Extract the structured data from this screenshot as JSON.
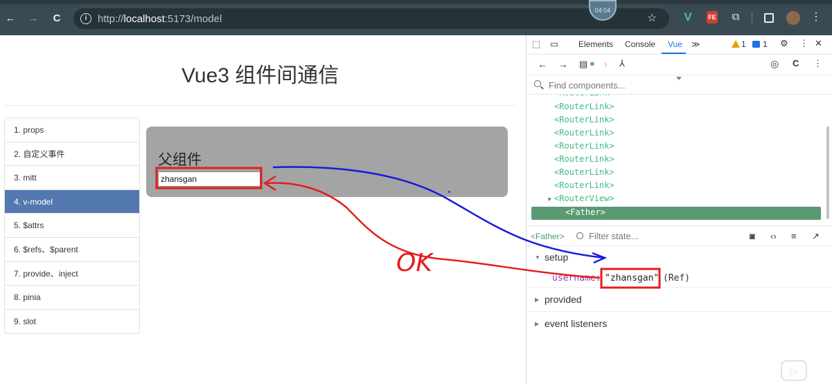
{
  "browser": {
    "url_prefix": "http://",
    "url_host": "localhost",
    "url_rest": ":5173/model",
    "timer": "04:04",
    "back": "←",
    "forward": "→",
    "reload": "C"
  },
  "page": {
    "title": "Vue3 组件间通信",
    "nav": [
      {
        "label": "1. props",
        "active": false
      },
      {
        "label": "2. 自定义事件",
        "active": false
      },
      {
        "label": "3. mitt",
        "active": false
      },
      {
        "label": "4. v-model",
        "active": true
      },
      {
        "label": "5. $attrs",
        "active": false
      },
      {
        "label": "6. $refs、$parent",
        "active": false
      },
      {
        "label": "7. provide、inject",
        "active": false
      },
      {
        "label": "8. pinia",
        "active": false
      },
      {
        "label": "9. slot",
        "active": false
      }
    ],
    "father_title": "父组件",
    "father_input_value": "zhansgan"
  },
  "annotation": {
    "ok_text": "OK",
    "arrow_color_blue": "#1a1adb",
    "arrow_color_red": "#e51c1c"
  },
  "devtools": {
    "tabs": [
      "Elements",
      "Console",
      "Vue"
    ],
    "active_tab": "Vue",
    "more": "≫",
    "warnings": "1",
    "messages": "1",
    "search_placeholder": "Find components...",
    "tree_rows": [
      "<RouterLink>",
      "<RouterLink>",
      "<RouterLink>",
      "<RouterLink>",
      "<RouterLink>",
      "<RouterLink>",
      "<RouterLink>",
      "<RouterLink>"
    ],
    "router_view": "<RouterView>",
    "selected": "<Father>",
    "state_component": "<Father>",
    "filter_placeholder": "Filter state...",
    "setup_label": "setup",
    "state_key": "username:",
    "state_value": "\"zhansgan\"",
    "state_type": "(Ref)",
    "provided_label": "provided",
    "listeners_label": "event listeners"
  },
  "colors": {
    "accent": "#1a73e8",
    "vue_green": "#41b883",
    "nav_active": "#5378b0"
  }
}
